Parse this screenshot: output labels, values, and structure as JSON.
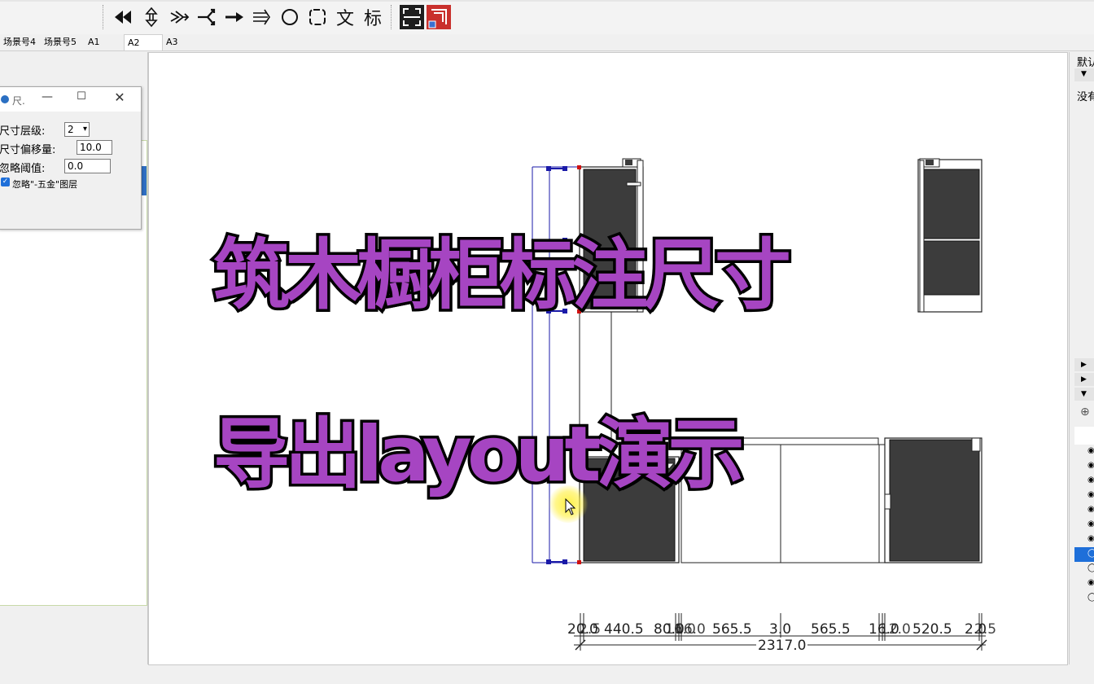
{
  "toolbar": {
    "text_tool": "文",
    "label_tool": "标"
  },
  "tabs": [
    "场景号4",
    "场景号5",
    "A1",
    "A2",
    "A3"
  ],
  "active_tab": "A2",
  "dialog": {
    "title": "尺.",
    "level_label": "尺寸层级:",
    "level_value": "2",
    "offset_label": "尺寸偏移量:",
    "offset_value": "10.0",
    "threshold_label": "忽略阈值:",
    "threshold_value": "0.0",
    "ignore_label": "忽略\"-五金\"图层",
    "ignore_checked": true
  },
  "right_panel": {
    "header": "默认",
    "no_item": "没有"
  },
  "dimensions": {
    "segments": [
      "20.0",
      "2.5",
      "440.5",
      "80.0",
      "16.0",
      "16.0",
      "565.5",
      "3.0",
      "565.5",
      "16.0",
      "12.0",
      "520.5",
      "2.0",
      "2.5"
    ],
    "total": "2317.0"
  },
  "overlay": {
    "line1": "筑木橱柜标注尺寸",
    "line2": "导出layout演示"
  },
  "colors": {
    "overlay_fill": "#a645c2",
    "overlay_stroke": "#000000",
    "cabinet_fill": "#3c3c3c",
    "dimension_blue": "#1a1aa8",
    "dimension_red": "#d01010",
    "selection_blue": "#1e6fd9"
  }
}
